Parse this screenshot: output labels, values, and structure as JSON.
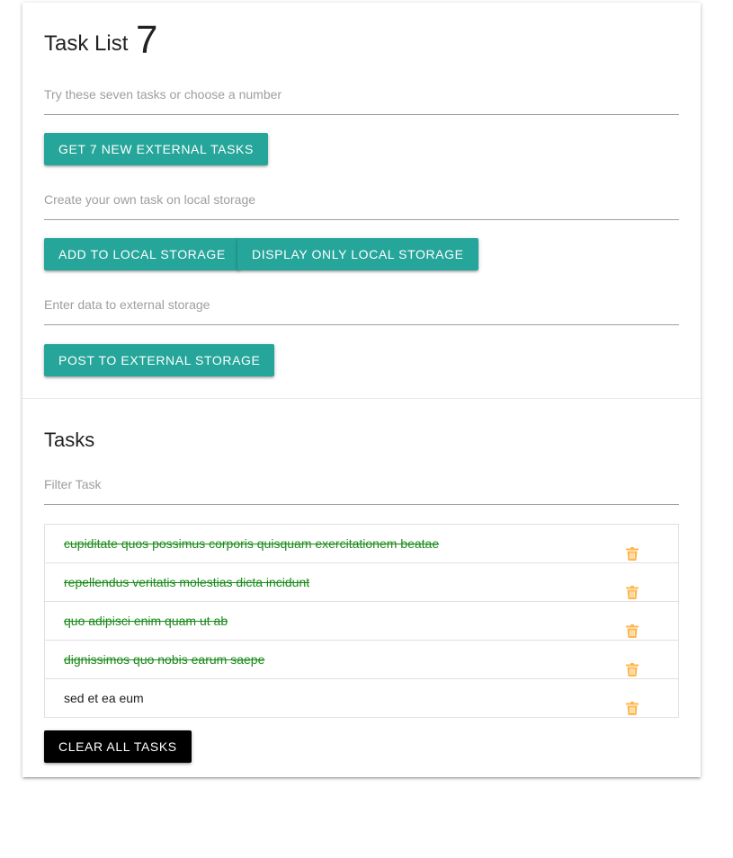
{
  "header": {
    "title": "Task List",
    "title_number": "7"
  },
  "fetch_section": {
    "number_placeholder": "Try these seven tasks or choose a number",
    "get_button_label": "GET 7 NEW EXTERNAL TASKS"
  },
  "local_section": {
    "task_placeholder": "Create your own task on local storage",
    "add_button_label": "ADD TO LOCAL STORAGE",
    "display_button_label": "DISPLAY ONLY LOCAL STORAGE"
  },
  "external_section": {
    "data_placeholder": "Enter data to external storage",
    "post_button_label": "POST TO EXTERNAL STORAGE"
  },
  "tasks_section": {
    "title": "Tasks",
    "filter_placeholder": "Filter Task",
    "items": [
      {
        "text": "cupiditate quos possimus corporis quisquam exercitationem beatae",
        "completed": true
      },
      {
        "text": "repellendus veritatis molestias dicta incidunt",
        "completed": true
      },
      {
        "text": "quo adipisci enim quam ut ab",
        "completed": true
      },
      {
        "text": "dignissimos quo nobis earum saepe",
        "completed": true
      },
      {
        "text": "sed et ea eum",
        "completed": false
      }
    ],
    "clear_button_label": "CLEAR ALL TASKS"
  },
  "icons": {
    "delete": "trash-icon"
  },
  "colors": {
    "accent": "#26a69a",
    "completed_text": "#1a8a1a",
    "delete_icon": "#ffb74d",
    "clear_button": "#000000"
  }
}
